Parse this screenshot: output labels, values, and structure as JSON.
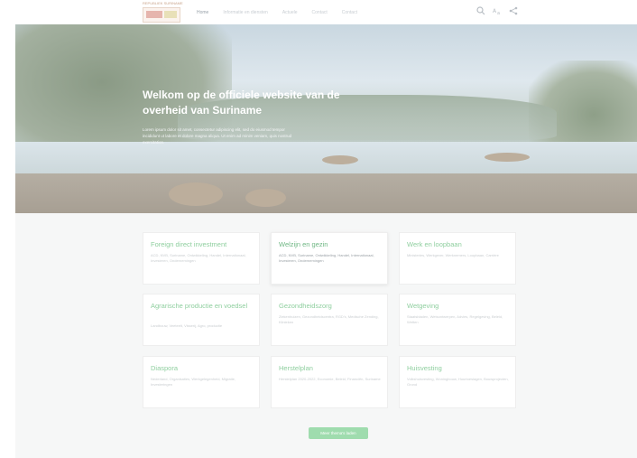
{
  "header": {
    "logo_text": "REPUBLIEK SURINAME",
    "nav": [
      "Home",
      "Informatie en diensten",
      "Actuele",
      "Contact",
      "Contact"
    ],
    "icons": [
      "search-icon",
      "translate-icon",
      "share-icon"
    ]
  },
  "hero": {
    "title": "Welkom op de officiele website van de overheid van Suriname",
    "text": "Lorem ipsum dolor sit amet, consectetur adipiscing elit, sed do eiusmod tempor incididunt ut labore et dolore magna aliqua. Ut enim ad minim veniam, quis nostrud exercitation."
  },
  "cards": [
    {
      "title": "Foreign direct investment",
      "desc": "ACD, NVB, Suriname, Ontwikkeling, Handel, Internationaal, Investeren, Ondernemingen"
    },
    {
      "title": "Welzijn en gezin",
      "desc": "ACD, NVB, Suriname, Ontwikkeling, Handel, Internationaal, Investeren, Ondernemingen"
    },
    {
      "title": "Werk en loopbaan",
      "desc": "Ministeries, Werkgever, Werknemers, Loopbaan, Carrière"
    },
    {
      "title": "Agrarische productie en voedsel",
      "desc": "Landbouw, Veeteelt, Visserij, Agro, productie"
    },
    {
      "title": "Gezondheidszorg",
      "desc": "Ziekenhuizen, Gezondheidscentra, RGD's, Medische Zending, Klinieken"
    },
    {
      "title": "Wetgeving",
      "desc": "Staatsbladen, Wetsontwerpen, Advies, Regelgeving, Beleid, Wetten"
    },
    {
      "title": "Diaspora",
      "desc": "Nederland, Organisaties, Werkgelegenheid, Migratie, Investeringen"
    },
    {
      "title": "Herstelplan",
      "desc": "Herstelplan 2020-2022, Economie, Beleid, Financiën, Suriname"
    },
    {
      "title": "Huisvesting",
      "desc": "Volkshuisvesting, Woningbouw, Huurtoeslagen, Bouwprojecten, Grond"
    }
  ],
  "more_button": "Meer thema's laden"
}
